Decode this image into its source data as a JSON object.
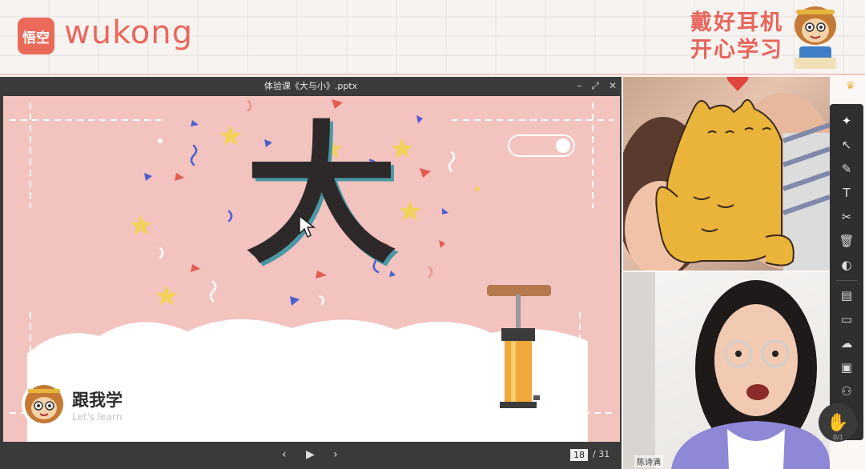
{
  "banner": {
    "logo_badge": "悟空",
    "logo_text": "wukong",
    "slogan_line1": "戴好耳机",
    "slogan_line2": "开心学习"
  },
  "ppt": {
    "title": "体验课《大与小》.pptx",
    "controls": {
      "minimize": "–",
      "restore": "⤢",
      "close": "✕"
    },
    "current_page": "18",
    "total_pages": "/ 31",
    "prev": "‹",
    "play": "▶",
    "next": "›"
  },
  "slide": {
    "character": "大",
    "follow_label": "跟我学",
    "follow_sub": "Let's learn"
  },
  "video": {
    "student_name": "",
    "teacher_name": "陈诗满"
  },
  "toolbar": {
    "tools": [
      {
        "name": "laser-pointer",
        "glyph": "✦"
      },
      {
        "name": "select-move",
        "glyph": "↖"
      },
      {
        "name": "pen",
        "glyph": "✎"
      },
      {
        "name": "text",
        "glyph": "T"
      },
      {
        "name": "scissors",
        "glyph": "✂"
      },
      {
        "name": "delete",
        "glyph": "🗑"
      },
      {
        "name": "toggle",
        "glyph": "◐"
      },
      {
        "name": "notes",
        "glyph": "▤"
      },
      {
        "name": "chat",
        "glyph": "▭"
      },
      {
        "name": "cloud",
        "glyph": "☁"
      },
      {
        "name": "toolbox",
        "glyph": "▣"
      },
      {
        "name": "users",
        "glyph": "⚇"
      }
    ],
    "hand_count": "0/1"
  },
  "colors": {
    "brand": "#e9685c",
    "slide_bg": "#f3c3c0",
    "toolbar_bg": "#2f2f2f"
  }
}
